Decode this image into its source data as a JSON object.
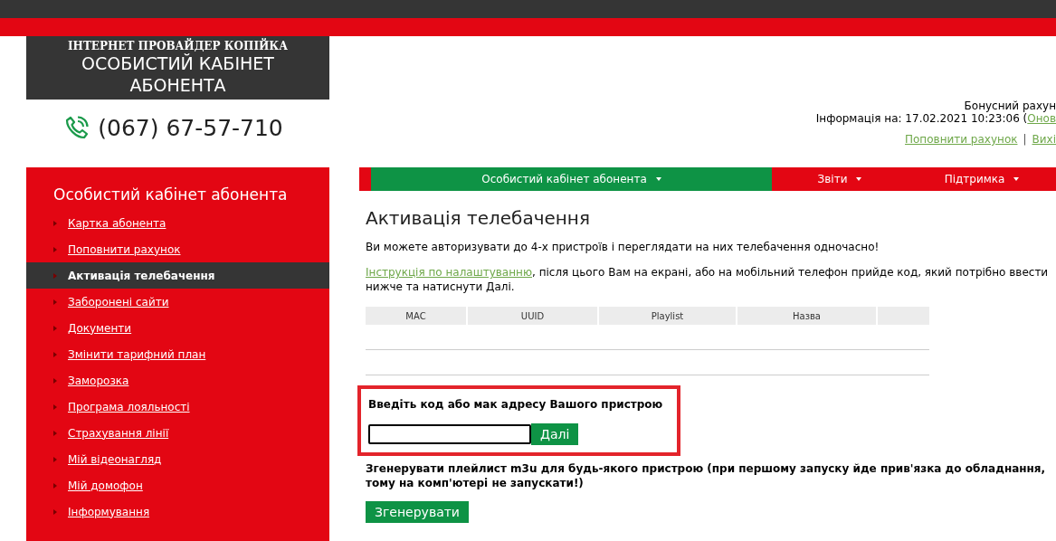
{
  "header": {
    "provider": "ІНТЕРНЕТ ПРОВАЙДЕР КОПІЙКА",
    "title": "ОСОБИСТИЙ КАБІНЕТ АБОНЕНТА",
    "phone": "(067) 67-57-710"
  },
  "account": {
    "bonus": "Бонусний рахун",
    "info": "Інформація на: 17.02.2021 10:23:06 (",
    "refresh_link": "Онов",
    "top_up_link": "Поповнити рахунок",
    "separator": "|",
    "logout_link": "Вихі"
  },
  "sidebar": {
    "title": "Особистий кабінет абонента",
    "items": [
      {
        "label": "Картка абонента",
        "selected": false
      },
      {
        "label": "Поповнити рахунок",
        "selected": false
      },
      {
        "label": "Активація телебачення",
        "selected": true
      },
      {
        "label": "Заборонені сайти",
        "selected": false
      },
      {
        "label": "Документи",
        "selected": false
      },
      {
        "label": "Змінити тарифний план",
        "selected": false
      },
      {
        "label": "Заморозка",
        "selected": false
      },
      {
        "label": "Програма лояльності",
        "selected": false
      },
      {
        "label": "Страхування лінії",
        "selected": false
      },
      {
        "label": "Мій відеонагляд",
        "selected": false
      },
      {
        "label": "Мій домофон",
        "selected": false
      },
      {
        "label": "Інформування",
        "selected": false
      }
    ]
  },
  "nav": [
    {
      "label": "Особистий кабінет абонента",
      "selected": true
    },
    {
      "label": "Звіти",
      "selected": false
    },
    {
      "label": "Підтримка",
      "selected": false
    }
  ],
  "page": {
    "title": "Активація телебачення",
    "intro": "Ви можете авторизувати до 4-х пристроїв і переглядати на них телебачення одночасно!",
    "instruction_link": "Інструкція по налаштуванню",
    "instruction_text": ", після цього Вам на екрані, або на мобільний телефон прийде код, який потрібно ввести нижче та натиснути Далі."
  },
  "table": {
    "columns": [
      "MAC",
      "UUID",
      "Playlist",
      "Назва",
      ""
    ]
  },
  "code_form": {
    "label": "Введіть код або мак адресу Вашого пристрою",
    "next_button": "Далі"
  },
  "playlist": {
    "text": "Згенерувати плейлист m3u для будь-якого пристрою (при першому запуску йде прив'язка до обладнання, тому на комп'ютері не запускати!)",
    "button": "Згенерувати"
  }
}
